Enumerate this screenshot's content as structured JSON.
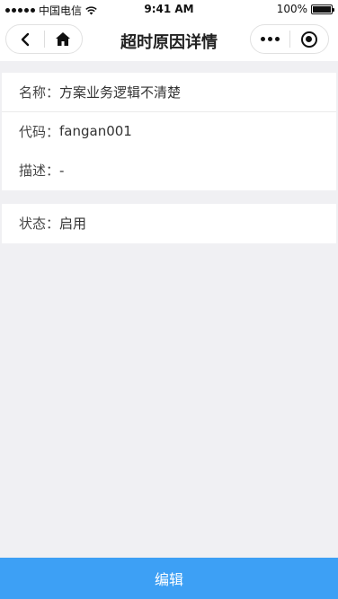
{
  "status_bar": {
    "carrier": "中国电信",
    "time": "9:41 AM",
    "battery": "100%"
  },
  "nav": {
    "title": "超时原因详情",
    "back_icon": "chevron-left-icon",
    "home_icon": "home-icon",
    "more_icon": "more-dots-icon",
    "close_icon": "target-circle-icon"
  },
  "details": {
    "name_label": "名称：",
    "name_value": "方案业务逻辑不清楚",
    "code_label": "代码：",
    "code_value": "fangan001",
    "desc_label": "描述：",
    "desc_value": "-"
  },
  "status": {
    "label": "状态：",
    "value": "启用"
  },
  "footer": {
    "edit_label": "编辑",
    "button_color": "#3da0f5"
  }
}
